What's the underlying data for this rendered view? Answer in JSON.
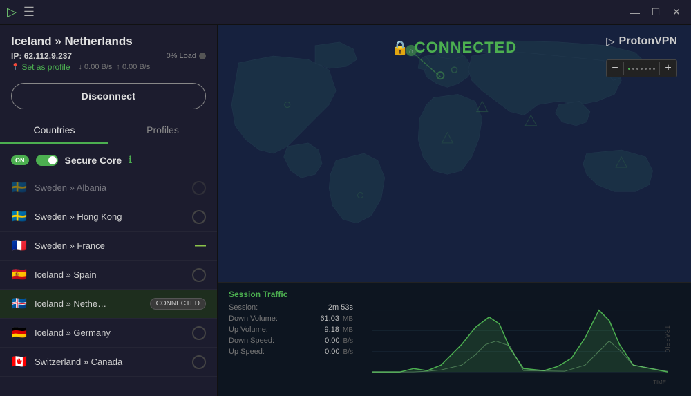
{
  "titlebar": {
    "logo": "▷",
    "menu_icon": "☰",
    "minimize_label": "—",
    "maximize_label": "☐",
    "close_label": "✕"
  },
  "connection": {
    "server_name": "Iceland » Netherlands",
    "ip_label": "IP:",
    "ip_address": "62.112.9.237",
    "load_label": "0% Load",
    "set_profile_label": "Set as profile",
    "down_speed": "↓ 0.00 B/s",
    "up_speed": "↑ 0.00 B/s",
    "disconnect_label": "Disconnect"
  },
  "tabs": {
    "countries_label": "Countries",
    "profiles_label": "Profiles"
  },
  "secure_core": {
    "toggle_label": "ON",
    "label": "Secure Core",
    "info": "ℹ"
  },
  "servers": [
    {
      "flag": "🇸🇪",
      "name": "Sweden » Hong Kong",
      "load": "circle",
      "connected": false,
      "faded": false
    },
    {
      "flag": "🇫🇷",
      "name": "Sweden » France",
      "load": "minus",
      "connected": false,
      "faded": false
    },
    {
      "flag": "🇪🇸",
      "name": "Iceland » Spain",
      "load": "circle",
      "connected": false,
      "faded": false
    },
    {
      "flag": "🇮🇸",
      "name": "Iceland » Nethe…",
      "load": "circle",
      "connected": true,
      "faded": false
    },
    {
      "flag": "🇩🇪",
      "name": "Iceland » Germany",
      "load": "circle",
      "connected": false,
      "faded": false
    },
    {
      "flag": "🇨🇦",
      "name": "Switzerland » Canada",
      "load": "circle",
      "connected": false,
      "faded": false
    }
  ],
  "map": {
    "connected_label": "CONNECTED",
    "lock_icon": "🔒",
    "home_icon": "🏠"
  },
  "proton": {
    "icon": "▷",
    "label": "ProtonVPN"
  },
  "zoom": {
    "minus_label": "−",
    "plus_label": "+"
  },
  "traffic": {
    "title": "Session Traffic",
    "session_label": "Session:",
    "session_value": "2m 53s",
    "down_volume_label": "Down Volume:",
    "down_volume_value": "61.03",
    "down_volume_unit": "MB",
    "up_volume_label": "Up Volume:",
    "up_volume_value": "9.18",
    "up_volume_unit": "MB",
    "down_speed_label": "Down Speed:",
    "down_speed_value": "0.00",
    "down_speed_unit": "B/s",
    "up_speed_label": "Up Speed:",
    "up_speed_value": "0.00",
    "up_speed_unit": "B/s",
    "time_label": "TIME",
    "traffic_label": "TRAFFIC"
  }
}
